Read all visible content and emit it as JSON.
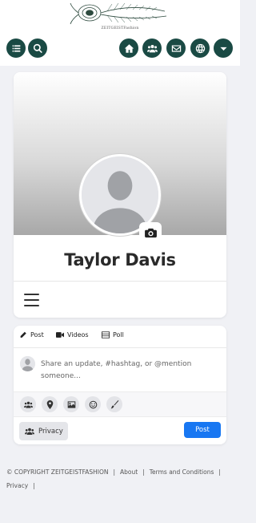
{
  "header": {
    "logo_text": "ZEITGEISTFashion",
    "icons": [
      "list-icon",
      "search-icon",
      "home-icon",
      "users-icon",
      "envelope-icon",
      "globe-icon",
      "chevron-down-icon"
    ]
  },
  "profile": {
    "name": "Taylor Davis"
  },
  "composer": {
    "tabs": [
      {
        "label": "Post",
        "icon": "pencil-icon"
      },
      {
        "label": "Videos",
        "icon": "video-icon"
      },
      {
        "label": "Poll",
        "icon": "poll-icon"
      }
    ],
    "placeholder": "Share an update, #hashtag, or @mention someone...",
    "tools": [
      "users-icon",
      "map-pin-icon",
      "image-icon",
      "smile-icon",
      "brush-icon"
    ],
    "privacy_label": "Privacy",
    "post_label": "Post"
  },
  "footer": {
    "copyright": "© COPYRIGHT ZEITGEISTFASHION",
    "links": [
      "About",
      "Terms and Conditions",
      "Privacy"
    ],
    "separator": "|"
  },
  "colors": {
    "nav_button": "#1a4a44",
    "post_button": "#1877f2",
    "page_bg": "#f0f1f5"
  }
}
